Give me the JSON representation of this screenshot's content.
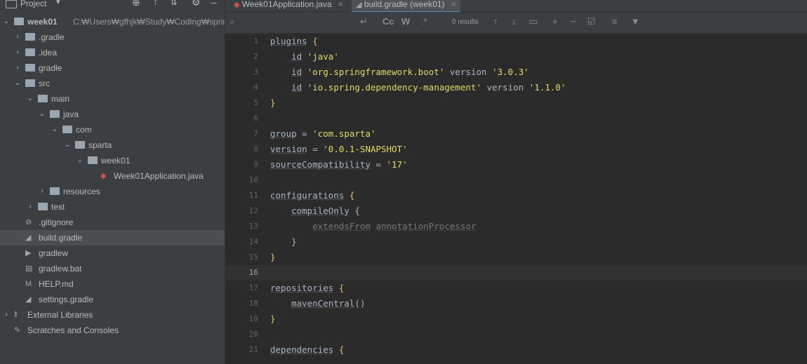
{
  "project_panel": {
    "title": "Project",
    "tree": [
      {
        "label": "week01",
        "path": "C:₩Users₩gfhjk₩Study₩Coding₩spring₩sp",
        "level": 0,
        "arrow": "v",
        "icon": "module-folder-icon"
      },
      {
        "label": ".gradle",
        "level": 1,
        "arrow": ">",
        "icon": "folder-icon"
      },
      {
        "label": ".idea",
        "level": 1,
        "arrow": ">",
        "icon": "folder-icon"
      },
      {
        "label": "gradle",
        "level": 1,
        "arrow": ">",
        "icon": "folder-icon"
      },
      {
        "label": "src",
        "level": 1,
        "arrow": "v",
        "icon": "folder-icon"
      },
      {
        "label": "main",
        "level": 2,
        "arrow": "v",
        "icon": "folder-icon"
      },
      {
        "label": "java",
        "level": 3,
        "arrow": "v",
        "icon": "folder-icon"
      },
      {
        "label": "com",
        "level": 4,
        "arrow": "v",
        "icon": "folder-icon"
      },
      {
        "label": "sparta",
        "level": 5,
        "arrow": "v",
        "icon": "folder-icon"
      },
      {
        "label": "week01",
        "level": 6,
        "arrow": "v",
        "icon": "folder-icon"
      },
      {
        "label": "Week01Application.java",
        "level": 7,
        "arrow": "",
        "icon": "java-class-icon"
      },
      {
        "label": "resources",
        "level": 3,
        "arrow": ">",
        "icon": "folder-icon"
      },
      {
        "label": "test",
        "level": 2,
        "arrow": ">",
        "icon": "folder-icon"
      },
      {
        "label": ".gitignore",
        "level": 1,
        "arrow": "",
        "icon": "gitignore-file-icon"
      },
      {
        "label": "build.gradle",
        "level": 1,
        "arrow": "",
        "icon": "gradle-file-icon",
        "selected": true
      },
      {
        "label": "gradlew",
        "level": 1,
        "arrow": "",
        "icon": "shell-file-icon"
      },
      {
        "label": "gradlew.bat",
        "level": 1,
        "arrow": "",
        "icon": "bat-file-icon"
      },
      {
        "label": "HELP.md",
        "level": 1,
        "arrow": "",
        "icon": "markdown-file-icon"
      },
      {
        "label": "settings.gradle",
        "level": 1,
        "arrow": "",
        "icon": "gradle-file-icon"
      },
      {
        "label": "External Libraries",
        "level": 0,
        "arrow": ">",
        "icon": "libraries-icon"
      },
      {
        "label": "Scratches and Consoles",
        "level": 0,
        "arrow": "",
        "icon": "scratches-icon"
      }
    ]
  },
  "tabs": [
    {
      "label": "Week01Application.java",
      "active": false
    },
    {
      "label": "build.gradle (week01)",
      "active": true
    }
  ],
  "search": {
    "results_text": "0 results",
    "toolbar": {
      "case_label": "Cc",
      "word_label": "W",
      "regex_label": ".*"
    }
  },
  "current_line": 16,
  "code_lines": [
    {
      "n": "1",
      "segs": [
        [
          "kw",
          "plugins"
        ],
        [
          "br",
          " {"
        ]
      ]
    },
    {
      "n": "2",
      "segs": [
        [
          "plain",
          "    "
        ],
        [
          "kw",
          "id"
        ],
        [
          "plain",
          " "
        ],
        [
          "str",
          "'java'"
        ]
      ]
    },
    {
      "n": "3",
      "segs": [
        [
          "plain",
          "    "
        ],
        [
          "kw",
          "id"
        ],
        [
          "plain",
          " "
        ],
        [
          "str",
          "'org.springframework.boot'"
        ],
        [
          "plain",
          " version "
        ],
        [
          "str",
          "'3.0.3'"
        ]
      ]
    },
    {
      "n": "4",
      "segs": [
        [
          "plain",
          "    "
        ],
        [
          "kw",
          "id"
        ],
        [
          "plain",
          " "
        ],
        [
          "str",
          "'io.spring.dependency-management'"
        ],
        [
          "plain",
          " version "
        ],
        [
          "str",
          "'1.1.0'"
        ]
      ]
    },
    {
      "n": "5",
      "segs": [
        [
          "br",
          "}"
        ]
      ]
    },
    {
      "n": "6",
      "segs": []
    },
    {
      "n": "7",
      "segs": [
        [
          "kw",
          "group"
        ],
        [
          "plain",
          " = "
        ],
        [
          "str",
          "'com.sparta'"
        ]
      ]
    },
    {
      "n": "8",
      "segs": [
        [
          "kw",
          "version"
        ],
        [
          "plain",
          " = "
        ],
        [
          "str",
          "'0.0.1-SNAPSHOT'"
        ]
      ]
    },
    {
      "n": "9",
      "segs": [
        [
          "kw",
          "sourceCompatibility"
        ],
        [
          "plain",
          " = "
        ],
        [
          "str",
          "'17'"
        ]
      ]
    },
    {
      "n": "10",
      "segs": []
    },
    {
      "n": "11",
      "segs": [
        [
          "kw",
          "configurations"
        ],
        [
          "br",
          " {"
        ]
      ]
    },
    {
      "n": "12",
      "segs": [
        [
          "plain",
          "    "
        ],
        [
          "kw",
          "compileOnly"
        ],
        [
          "plain",
          " {"
        ]
      ]
    },
    {
      "n": "13",
      "segs": [
        [
          "plain",
          "        "
        ],
        [
          "dim",
          "extendsFrom"
        ],
        [
          "plain",
          " "
        ],
        [
          "dim",
          "annotationProcessor"
        ]
      ]
    },
    {
      "n": "14",
      "segs": [
        [
          "plain",
          "    }"
        ]
      ]
    },
    {
      "n": "15",
      "segs": [
        [
          "br",
          "}"
        ]
      ]
    },
    {
      "n": "16",
      "segs": []
    },
    {
      "n": "17",
      "segs": [
        [
          "kw",
          "repositories"
        ],
        [
          "br",
          " {"
        ]
      ]
    },
    {
      "n": "18",
      "segs": [
        [
          "plain",
          "    "
        ],
        [
          "kw",
          "mavenCentral"
        ],
        [
          "plain",
          "()"
        ]
      ]
    },
    {
      "n": "19",
      "segs": [
        [
          "br",
          "}"
        ]
      ]
    },
    {
      "n": "20",
      "segs": []
    },
    {
      "n": "21",
      "segs": [
        [
          "kw",
          "dependencies"
        ],
        [
          "br",
          " {"
        ]
      ]
    }
  ]
}
